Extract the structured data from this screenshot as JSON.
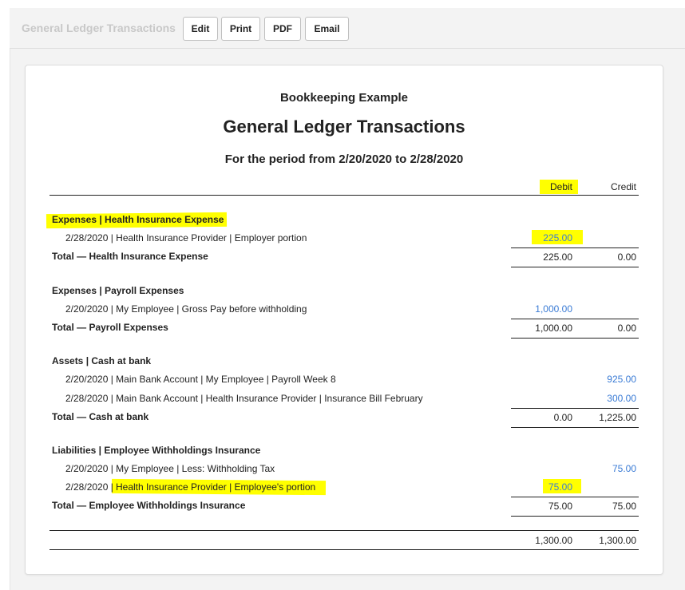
{
  "toolbar": {
    "title": "General Ledger Transactions",
    "edit_label": "Edit",
    "print_label": "Print",
    "pdf_label": "PDF",
    "email_label": "Email"
  },
  "report": {
    "company": "Bookkeeping Example",
    "title": "General Ledger Transactions",
    "period": "For the period from 2/20/2020 to 2/28/2020",
    "columns": {
      "debit": "Debit",
      "credit": "Credit"
    },
    "groups": [
      {
        "heading": "Expenses | Health Insurance Expense",
        "rows": [
          {
            "desc": "2/28/2020 | Health Insurance Provider | Employer portion",
            "debit": "225.00",
            "credit": ""
          }
        ],
        "total_label": "Total — Health Insurance Expense",
        "total_debit": "225.00",
        "total_credit": "0.00"
      },
      {
        "heading": "Expenses | Payroll Expenses",
        "rows": [
          {
            "desc": "2/20/2020 | My Employee | Gross Pay before withholding",
            "debit": "1,000.00",
            "credit": ""
          }
        ],
        "total_label": "Total — Payroll Expenses",
        "total_debit": "1,000.00",
        "total_credit": "0.00"
      },
      {
        "heading": "Assets | Cash at bank",
        "rows": [
          {
            "desc": "2/20/2020 | Main Bank Account | My Employee | Payroll Week 8",
            "debit": "",
            "credit": "925.00"
          },
          {
            "desc": "2/28/2020 | Main Bank Account | Health Insurance Provider | Insurance Bill February",
            "debit": "",
            "credit": "300.00"
          }
        ],
        "total_label": "Total — Cash at bank",
        "total_debit": "0.00",
        "total_credit": "1,225.00"
      },
      {
        "heading": "Liabilities | Employee Withholdings Insurance",
        "rows": [
          {
            "desc": "2/20/2020 | My Employee | Less: Withholding Tax",
            "debit": "",
            "credit": "75.00"
          },
          {
            "date": "2/28/2020 |",
            "desc_rest": "Health Insurance Provider | Employee's portion",
            "debit": "75.00",
            "credit": ""
          }
        ],
        "total_label": "Total — Employee Withholdings Insurance",
        "total_debit": "75.00",
        "total_credit": "75.00"
      }
    ],
    "grand_total_debit": "1,300.00",
    "grand_total_credit": "1,300.00"
  },
  "colors": {
    "highlight": "#ffff00",
    "link_blue": "#3a7bd5"
  }
}
